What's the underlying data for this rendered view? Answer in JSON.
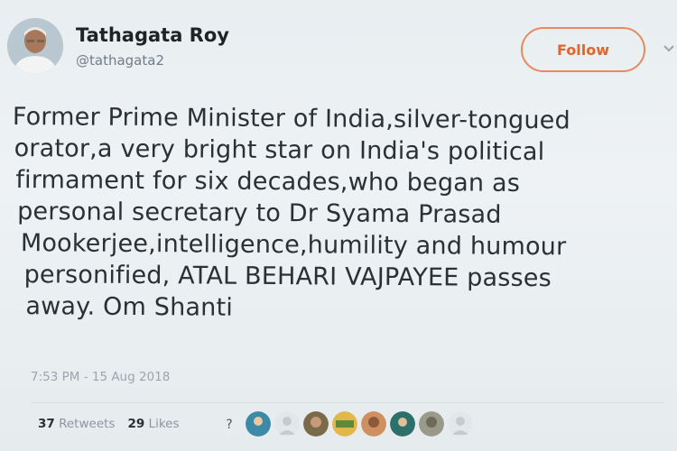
{
  "author": {
    "name": "Tathagata Roy",
    "handle": "@tathagata2"
  },
  "follow_label": "Follow",
  "tweet_lines": [
    "Former Prime Minister of India,silver-tongued",
    "orator,a very bright star on India's political",
    "firmament for six decades,who began as",
    "personal secretary to Dr Syama Prasad",
    "Mookerjee,intelligence,humility and humour",
    "personified, ATAL BEHARI VAJPAYEE passes",
    "away. Om Shanti"
  ],
  "timestamp": "7:53 PM - 15 Aug 2018",
  "stats": {
    "retweets_count": "37",
    "retweets_label": "Retweets",
    "likes_count": "29",
    "likes_label": "Likes"
  },
  "colors": {
    "accent": "#e0662d",
    "muted": "#8a979f"
  },
  "icons": {
    "menu": "chevron-down-icon"
  }
}
